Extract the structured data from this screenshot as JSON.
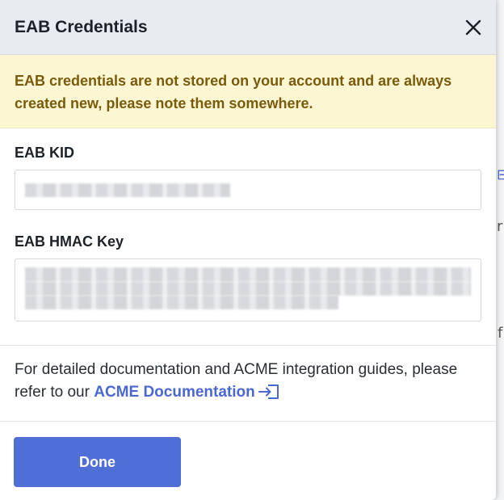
{
  "dialog": {
    "title": "EAB Credentials",
    "close_icon": "close-icon"
  },
  "alert": {
    "message": "EAB credentials are not stored on your account and are always created new, please note them somewhere."
  },
  "fields": {
    "kid_label": "EAB KID",
    "hmac_label": "EAB HMAC Key"
  },
  "docs": {
    "text": "For detailed documentation and ACME integration guides, please refer to our ",
    "link_label": "ACME Documentation",
    "link_icon": "external-link-icon",
    "link_color": "#4a68cf"
  },
  "footer": {
    "done_label": "Done",
    "done_color": "#4f6fd6"
  },
  "background": {
    "partial_glyph_r": "r",
    "partial_glyph_f": "f"
  }
}
